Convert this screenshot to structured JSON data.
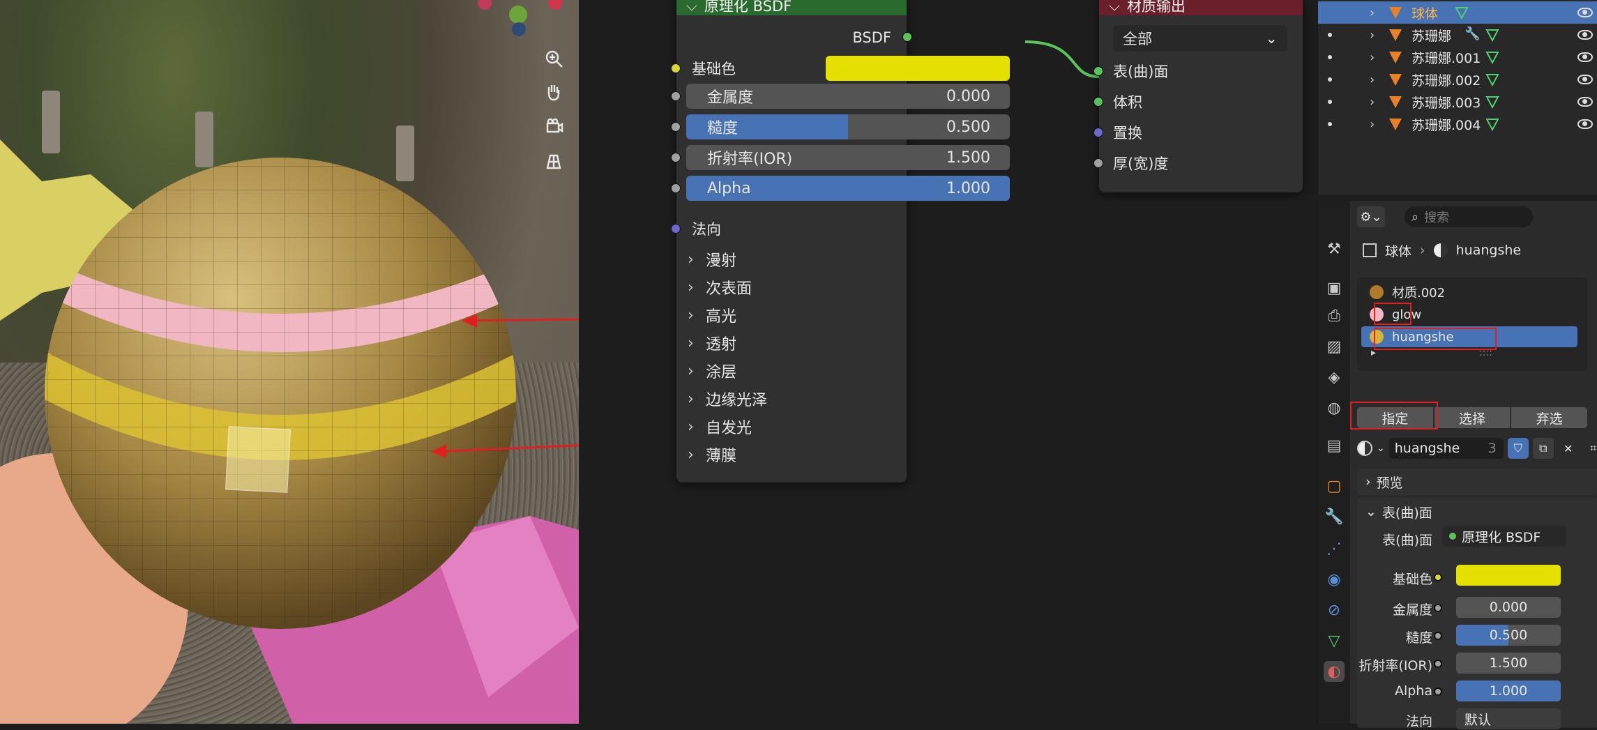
{
  "viewport": {
    "tools": [
      "zoom-icon",
      "hand-pan-icon",
      "camera-icon",
      "grid-icon"
    ]
  },
  "node_bsdf": {
    "title": "原理化 BSDF",
    "header_color": "#2b6a2f",
    "output_label": "BSDF",
    "base_color_label": "基础色",
    "base_color": "#e6e000",
    "sliders": [
      {
        "label": "金属度",
        "value": "0.000",
        "fraction": 0.0,
        "highlight": false
      },
      {
        "label": "糙度",
        "value": "0.500",
        "fraction": 0.5,
        "highlight": true
      },
      {
        "label": "折射率(IOR)",
        "value": "1.500",
        "fraction": 0.0,
        "highlight": false
      },
      {
        "label": "Alpha",
        "value": "1.000",
        "fraction": 1.0,
        "highlight": true
      }
    ],
    "normal_label": "法向",
    "subpanels": [
      "漫射",
      "次表面",
      "高光",
      "透射",
      "涂层",
      "边缘光泽",
      "自发光",
      "薄膜"
    ]
  },
  "node_output": {
    "title": "材质输出",
    "header_color": "#6b1f2a",
    "target": "全部",
    "inputs": [
      "表(曲)面",
      "体积",
      "置换",
      "厚(宽)度"
    ]
  },
  "outliner": {
    "rows": [
      {
        "name": "球体",
        "selected": true
      },
      {
        "name": "苏珊娜",
        "selected": false
      },
      {
        "name": "苏珊娜.001",
        "selected": false
      },
      {
        "name": "苏珊娜.002",
        "selected": false
      },
      {
        "name": "苏珊娜.003",
        "selected": false
      },
      {
        "name": "苏珊娜.004",
        "selected": false
      }
    ]
  },
  "properties": {
    "search_placeholder": "搜索",
    "breadcrumb": {
      "object": "球体",
      "material": "huangshe"
    },
    "slots": [
      {
        "name": "材质.002",
        "color": "#b07a2a"
      },
      {
        "name": "glow",
        "color": "#f3b6c2"
      },
      {
        "name": "huangshe",
        "color": "#d8b33a"
      }
    ],
    "actions": {
      "assign": "指定",
      "select": "选择",
      "deselect": "弃选"
    },
    "material_name": "huangshe",
    "user_count": "3",
    "preview_label": "预览",
    "surface_panel_label": "表(曲)面",
    "surface_label": "表(曲)面",
    "surface_value": "原理化 BSDF",
    "base_color_label": "基础色",
    "base_color": "#e6e000",
    "props": [
      {
        "label": "金属度",
        "value": "0.000",
        "fraction": 0.0
      },
      {
        "label": "糙度",
        "value": "0.500",
        "fraction": 0.5
      },
      {
        "label": "折射率(IOR)",
        "value": "1.500",
        "fraction": 0.0
      },
      {
        "label": "Alpha",
        "value": "1.000",
        "fraction": 1.0
      }
    ],
    "cut_label": "法向",
    "cut_value": "默认"
  },
  "colors": {
    "selection_blue": "#4772b3",
    "annotation_red": "#e02020",
    "link_green": "#5bc35b"
  }
}
